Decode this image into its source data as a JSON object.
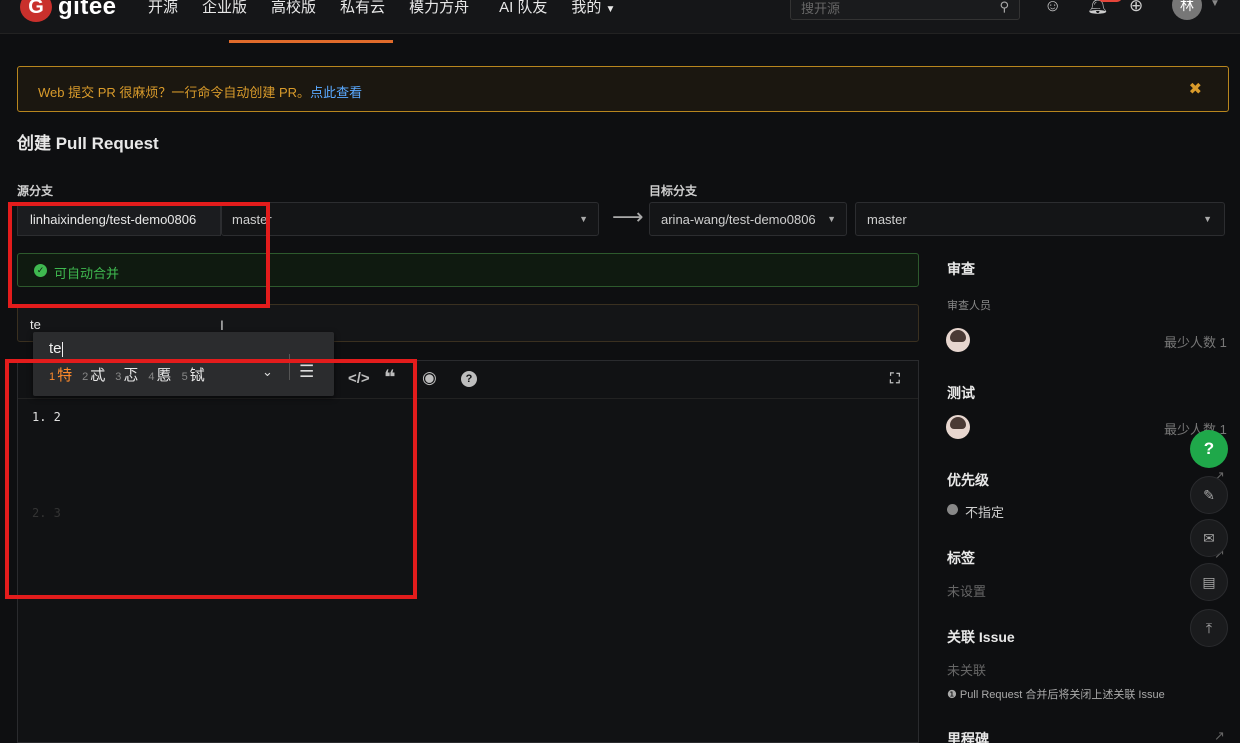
{
  "nav": {
    "logo_mark": "G",
    "logo_text": "gitee",
    "items": [
      "开源",
      "企业版",
      "高校版",
      "私有云",
      "模力方舟",
      "AI 队友",
      "我的"
    ],
    "search_placeholder": "搜开源",
    "avatar_char": "林"
  },
  "banner": {
    "text": "Web 提交 PR 很麻烦？一行命令自动创建 PR。",
    "link": "点此查看",
    "close": "✖"
  },
  "page_title": "创建 Pull Request",
  "source": {
    "label": "源分支",
    "repo": "linhaixindeng/test-demo0806",
    "branch": "master"
  },
  "target": {
    "label": "目标分支",
    "repo": "arina-wang/test-demo0806",
    "branch": "master"
  },
  "merge_status": "可自动合并",
  "title_input_value": "te",
  "ime": {
    "input": "te",
    "candidates": [
      {
        "n": "1",
        "c": "特"
      },
      {
        "n": "2",
        "c": "忒"
      },
      {
        "n": "3",
        "c": "忑"
      },
      {
        "n": "4",
        "c": "慝"
      },
      {
        "n": "5",
        "c": "铽"
      }
    ]
  },
  "editor": {
    "line1": "1. 2",
    "line2": "2. 3"
  },
  "sidebar": {
    "review_title": "审查",
    "reviewer_label": "审查人员",
    "min_count": "最少人数 1",
    "test_title": "测试",
    "test_min_count": "最少人数 1",
    "priority_title": "优先级",
    "priority_value": "不指定",
    "tags_title": "标签",
    "tags_value": "未设置",
    "issue_title": "关联 Issue",
    "issue_value": "未关联",
    "issue_note": "Pull Request 合并后将关闭上述关联 Issue",
    "milestone_title": "里程碑"
  },
  "colors": {
    "accent_orange": "#e06b2b",
    "success_green": "#3fb950",
    "annotation_red": "#e31c1c",
    "help_green": "#1fa84a"
  }
}
